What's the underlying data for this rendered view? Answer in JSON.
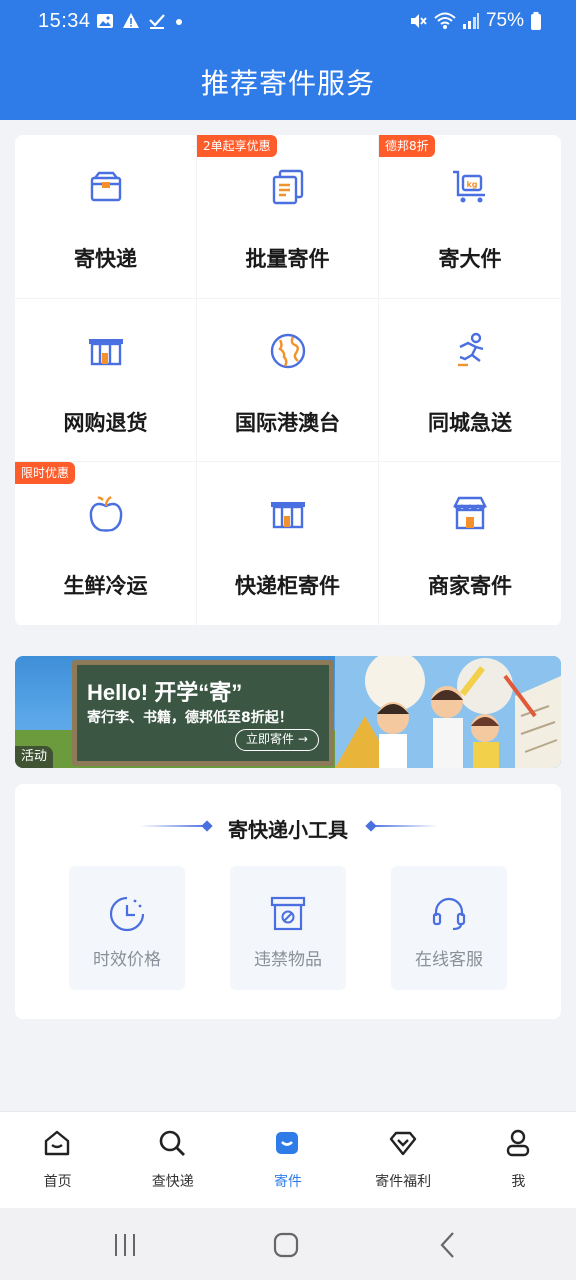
{
  "status_bar": {
    "time": "15:34",
    "battery": "75%"
  },
  "header": {
    "title": "推荐寄件服务"
  },
  "services": [
    {
      "label": "寄快递",
      "badge": "",
      "icon": "box-icon"
    },
    {
      "label": "批量寄件",
      "badge": "2单起享优惠",
      "icon": "documents-icon"
    },
    {
      "label": "寄大件",
      "badge": "德邦8折",
      "icon": "cart-kg-icon"
    },
    {
      "label": "网购退货",
      "badge": "",
      "icon": "locker-icon"
    },
    {
      "label": "国际港澳台",
      "badge": "",
      "icon": "globe-icon"
    },
    {
      "label": "同城急送",
      "badge": "",
      "icon": "runner-icon"
    },
    {
      "label": "生鲜冷运",
      "badge": "限时优惠",
      "icon": "apple-icon"
    },
    {
      "label": "快递柜寄件",
      "badge": "",
      "icon": "locker-icon"
    },
    {
      "label": "商家寄件",
      "badge": "",
      "icon": "shop-icon"
    }
  ],
  "banner": {
    "headline": "Hello! 开学“寄”",
    "subline": "寄行李、书籍，德邦低至8折起！",
    "button": "立即寄件 →",
    "tag": "活动"
  },
  "tools": {
    "title": "寄快递小工具",
    "items": [
      {
        "label": "时效价格",
        "icon": "clock-icon"
      },
      {
        "label": "违禁物品",
        "icon": "prohibited-box-icon"
      },
      {
        "label": "在线客服",
        "icon": "headset-icon"
      }
    ]
  },
  "bottom_nav": [
    {
      "label": "首页",
      "icon": "home-icon",
      "active": false
    },
    {
      "label": "查快递",
      "icon": "search-icon",
      "active": false
    },
    {
      "label": "寄件",
      "icon": "send-icon",
      "active": true
    },
    {
      "label": "寄件福利",
      "icon": "gift-icon",
      "active": false
    },
    {
      "label": "我",
      "icon": "user-icon",
      "active": false
    }
  ],
  "colors": {
    "brand": "#2f7ce9",
    "badge": "#ff5c2b",
    "icon_orange": "#f3922c",
    "icon_blue": "#4a6fe0"
  }
}
